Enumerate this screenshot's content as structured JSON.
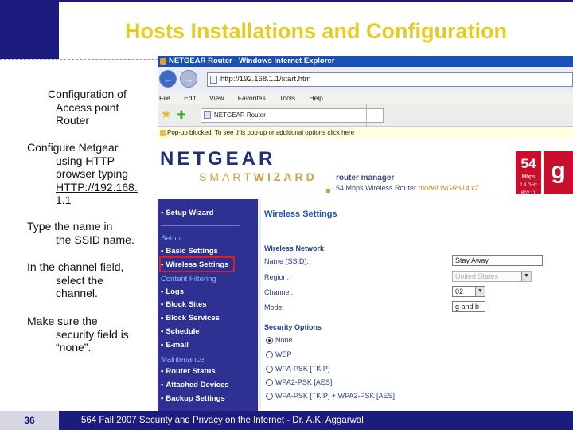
{
  "slide": {
    "title": "Hosts Installations and Configuration",
    "page_number": "36",
    "footer": "564 Fall 2007 Security and Privacy on the Internet - Dr. A.K. Aggarwal"
  },
  "notes": {
    "n1_l1": "Configuration of",
    "n1_l2": "Access point",
    "n1_l3": "Router",
    "n2_l1": "Configure Netgear",
    "n2_l2": "using HTTP",
    "n2_l3": "browser typing",
    "n2_l4": "HTTP://192.168.",
    "n2_l5": "1.1",
    "n3_l1": "Type the name in",
    "n3_l2": "the SSID name.",
    "n4_l1": "In the channel field,",
    "n4_l2": "select the",
    "n4_l3": "channel.",
    "n5_l1": "Make sure the",
    "n5_l2": "security field is",
    "n5_l3": "“none”."
  },
  "browser": {
    "window_title": "NETGEAR Router - Windows Internet Explorer",
    "address": "http://192.168.1.1/start.htm",
    "menu": [
      "File",
      "Edit",
      "View",
      "Favorites",
      "Tools",
      "Help"
    ],
    "tab_title": "NETGEAR Router",
    "infobar": "Pop-up blocked. To see this pop-up or additional options click here"
  },
  "router": {
    "brand": "NETGEAR",
    "smart": "SMART",
    "wizard": "WIZARD",
    "manager": "router manager",
    "model_line": "54 Mbps Wireless Router",
    "model_id": "model WGR614 v7",
    "badge_speed": "54",
    "badge_unit": "Mbps",
    "badge_band": "2.4 GHz",
    "badge_std": "802.11",
    "badge_g": "g",
    "nav": {
      "setup_wizard": "Setup Wizard",
      "setup_hdr": "Setup",
      "basic_settings": "Basic Settings",
      "wireless_settings": "Wireless Settings",
      "content_filtering_hdr": "Content Filtering",
      "logs": "Logs",
      "block_sites": "Block Sites",
      "block_services": "Block Services",
      "schedule": "Schedule",
      "email": "E-mail",
      "maintenance_hdr": "Maintenance",
      "router_status": "Router Status",
      "attached_devices": "Attached Devices",
      "backup_settings": "Backup Settings"
    },
    "panel": {
      "heading": "Wireless Settings",
      "wireless_network": "Wireless Network",
      "name_label": "Name (SSID):",
      "name_value": "Stay Away",
      "region_label": "Region:",
      "region_value": "United States",
      "channel_label": "Channel:",
      "channel_value": "02",
      "mode_label": "Mode:",
      "mode_value": "g and b",
      "security_options": "Security Options",
      "opt_none": "None",
      "opt_wep": "WEP",
      "opt_wpa_psk": "WPA-PSK [TKIP]",
      "opt_wpa2_psk": "WPA2-PSK [AES]",
      "opt_mixed": "WPA-PSK [TKIP] + WPA2-PSK [AES]"
    }
  }
}
